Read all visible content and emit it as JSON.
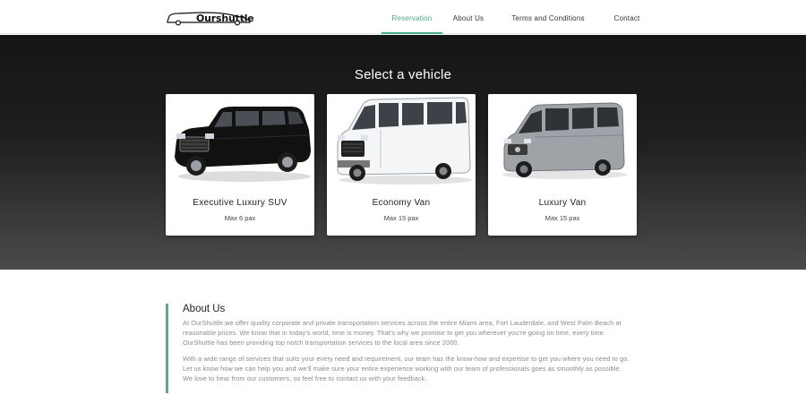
{
  "nav": {
    "logo_text": "Ourshuttle",
    "items": [
      {
        "label": "Reservation",
        "active": true
      },
      {
        "label": "About Us",
        "active": false
      },
      {
        "label": "Terms and Conditions",
        "active": false
      },
      {
        "label": "Contact",
        "active": false
      }
    ]
  },
  "hero": {
    "title": "Select a vehicle",
    "vehicles": [
      {
        "name": "Executive Luxury SUV",
        "pax": "Max 6 pax",
        "icon": "black-suv-image"
      },
      {
        "name": "Economy Van",
        "pax": "Max 15 pax",
        "icon": "white-van-image"
      },
      {
        "name": "Luxury Van",
        "pax": "Max 15 pax",
        "icon": "silver-sprinter-van-image"
      }
    ]
  },
  "about": {
    "title": "About Us",
    "paragraphs": [
      "At OurShuttle,we offer quality corporate and private transportation services across the entire Miami area, Fort Lauderdale, and West Palm Beach at reasonable prices. We know that in today’s world, time is money. That’s why we promise to get you wherever you’re going on time, every time. OurShuttle has been providing top notch transportation services to the local area since 2000.",
      "With a wide range of services that suits your every need and requirement, our team has the know-how and expertise to get you where you need to go. Let us know how we can help you and we’ll make sure your entire experience working with our team of professionals goes as smoothly as possible. We love to hear from our customers, so feel free to contact us with your feedback."
    ]
  },
  "colors": {
    "accent": "#4aa88c",
    "about_border": "#5fa593"
  }
}
